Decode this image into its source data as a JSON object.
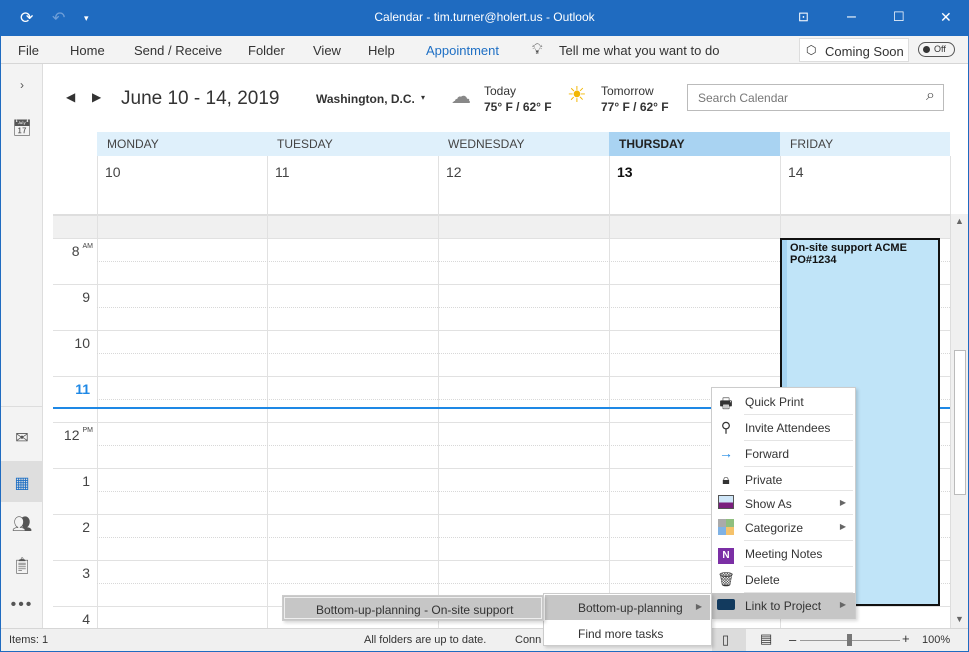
{
  "window": {
    "title": "Calendar - tim.turner@holert.us  -  Outlook"
  },
  "menu": {
    "items": [
      "File",
      "Home",
      "Send / Receive",
      "Folder",
      "View",
      "Help",
      "Appointment"
    ],
    "tell_me": "Tell me what you want to do",
    "coming_soon": "Coming Soon",
    "toggle": "Off"
  },
  "header": {
    "date_range": "June 10 - 14, 2019",
    "location": "Washington, D.C.",
    "today_label": "Today",
    "today_temp": "75° F / 62° F",
    "tomorrow_label": "Tomorrow",
    "tomorrow_temp": "77° F / 62° F",
    "search_placeholder": "Search Calendar"
  },
  "days": [
    {
      "name": "MONDAY",
      "num": "10"
    },
    {
      "name": "TUESDAY",
      "num": "11"
    },
    {
      "name": "WEDNESDAY",
      "num": "12"
    },
    {
      "name": "THURSDAY",
      "num": "13",
      "today": true
    },
    {
      "name": "FRIDAY",
      "num": "14"
    }
  ],
  "hours": [
    {
      "h": "8",
      "ampm": "AM"
    },
    {
      "h": "9",
      "ampm": ""
    },
    {
      "h": "10",
      "ampm": ""
    },
    {
      "h": "11",
      "ampm": "",
      "current": true
    },
    {
      "h": "12",
      "ampm": "PM"
    },
    {
      "h": "1",
      "ampm": ""
    },
    {
      "h": "2",
      "ampm": ""
    },
    {
      "h": "3",
      "ampm": ""
    },
    {
      "h": "4",
      "ampm": ""
    }
  ],
  "event": {
    "title": "On-site support ACME PO#1234",
    "day": "FRIDAY",
    "start": "8:00 AM",
    "end": "4:00 PM"
  },
  "context_menu": [
    {
      "label": "Quick Print",
      "icon": "printer-icon"
    },
    {
      "label": "Invite Attendees",
      "icon": "invite-attendees-icon"
    },
    {
      "label": "Forward",
      "icon": "forward-arrow-icon"
    },
    {
      "label": "Private",
      "icon": "lock-icon"
    },
    {
      "label": "Show As",
      "icon": "show-as-icon",
      "submenu": true
    },
    {
      "label": "Categorize",
      "icon": "categorize-icon",
      "submenu": true
    },
    {
      "label": "Meeting Notes",
      "icon": "onenote-icon"
    },
    {
      "label": "Delete",
      "icon": "trash-icon"
    },
    {
      "label": "Link to Project",
      "icon": "link-project-icon",
      "submenu": true,
      "highlighted": true
    }
  ],
  "submenu1": [
    {
      "label": "Bottom-up-planning",
      "submenu": true,
      "highlighted": true
    },
    {
      "label": "Find more tasks"
    }
  ],
  "submenu2": [
    {
      "label": "Bottom-up-planning - On-site support",
      "highlighted": true
    }
  ],
  "status": {
    "items": "Items: 1",
    "sync": "All folders are up to date.",
    "conn": "Conn",
    "zoom": "100%",
    "zoom_level": 100
  },
  "colors": {
    "titlebar": "#1f6bc0",
    "accent": "#1e88e5",
    "event_fill": "#c0e4f8",
    "today_header": "#a9d3f2"
  }
}
